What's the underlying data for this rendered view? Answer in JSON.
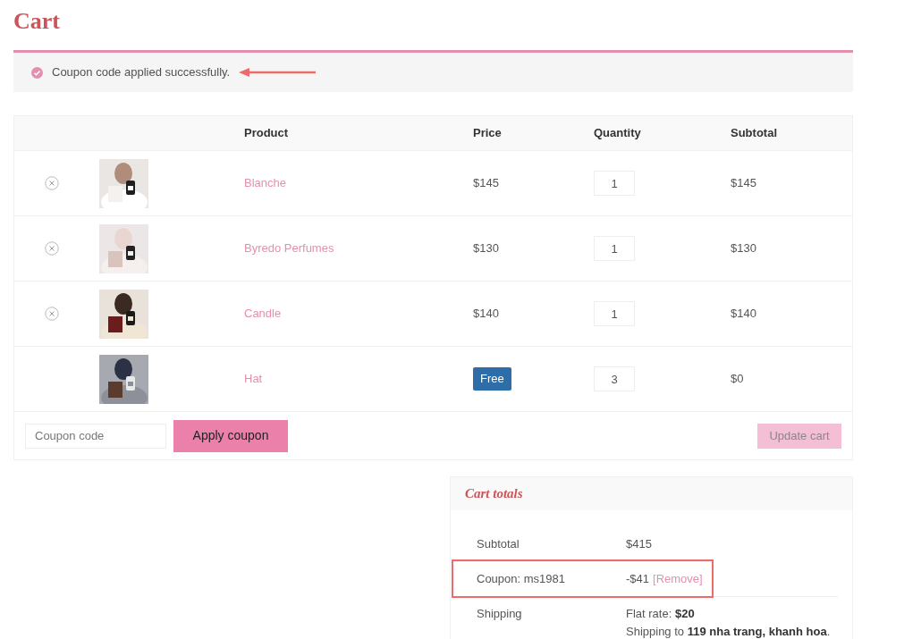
{
  "title": "Cart",
  "notice": {
    "message": "Coupon code applied successfully.",
    "annotated": true
  },
  "table": {
    "columns": [
      "Product",
      "Price",
      "Quantity",
      "Subtotal"
    ],
    "rows": [
      {
        "removable": true,
        "product": "Blanche",
        "price": {
          "kind": "text",
          "text": "$145"
        },
        "quantity": "1",
        "subtotal": "$145"
      },
      {
        "removable": true,
        "product": "Byredo Perfumes",
        "price": {
          "kind": "text",
          "text": "$130"
        },
        "quantity": "1",
        "subtotal": "$130"
      },
      {
        "removable": true,
        "product": "Candle",
        "price": {
          "kind": "text",
          "text": "$140"
        },
        "quantity": "1",
        "subtotal": "$140"
      },
      {
        "removable": false,
        "product": "Hat",
        "price": {
          "kind": "badge",
          "text": "Free"
        },
        "quantity": "3",
        "subtotal": "$0"
      }
    ]
  },
  "coupon": {
    "placeholder": "Coupon code",
    "apply_button": "Apply coupon",
    "update_button": "Update cart",
    "update_disabled": true
  },
  "totals": {
    "title": "Cart totals",
    "rows": [
      {
        "label": "Subtotal",
        "lines": [
          "$415"
        ],
        "highlighted": false
      },
      {
        "label": "Coupon: ms1981",
        "lines": [
          "-$41"
        ],
        "link": "[Remove]",
        "highlighted": true
      },
      {
        "label": "Shipping",
        "lines": [
          "Flat rate: **$20**",
          "Shipping to **119 nha trang, khanh hoa**."
        ],
        "highlighted": false
      }
    ]
  }
}
